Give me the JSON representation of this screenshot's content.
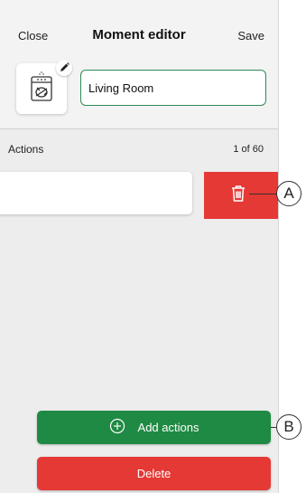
{
  "header": {
    "close_label": "Close",
    "title": "Moment editor",
    "save_label": "Save"
  },
  "moment": {
    "icon": "dishwasher-icon",
    "edit_icon": "pencil-icon",
    "name_value": "Living Room"
  },
  "actions": {
    "label": "Actions",
    "count": "1 of 60",
    "delete_icon": "trash-icon"
  },
  "buttons": {
    "add_actions_label": "Add actions",
    "delete_label": "Delete"
  },
  "callouts": {
    "a": "A",
    "b": "B"
  },
  "colors": {
    "green": "#1f8a43",
    "red": "#e53935",
    "field_border": "#2e8b57"
  }
}
